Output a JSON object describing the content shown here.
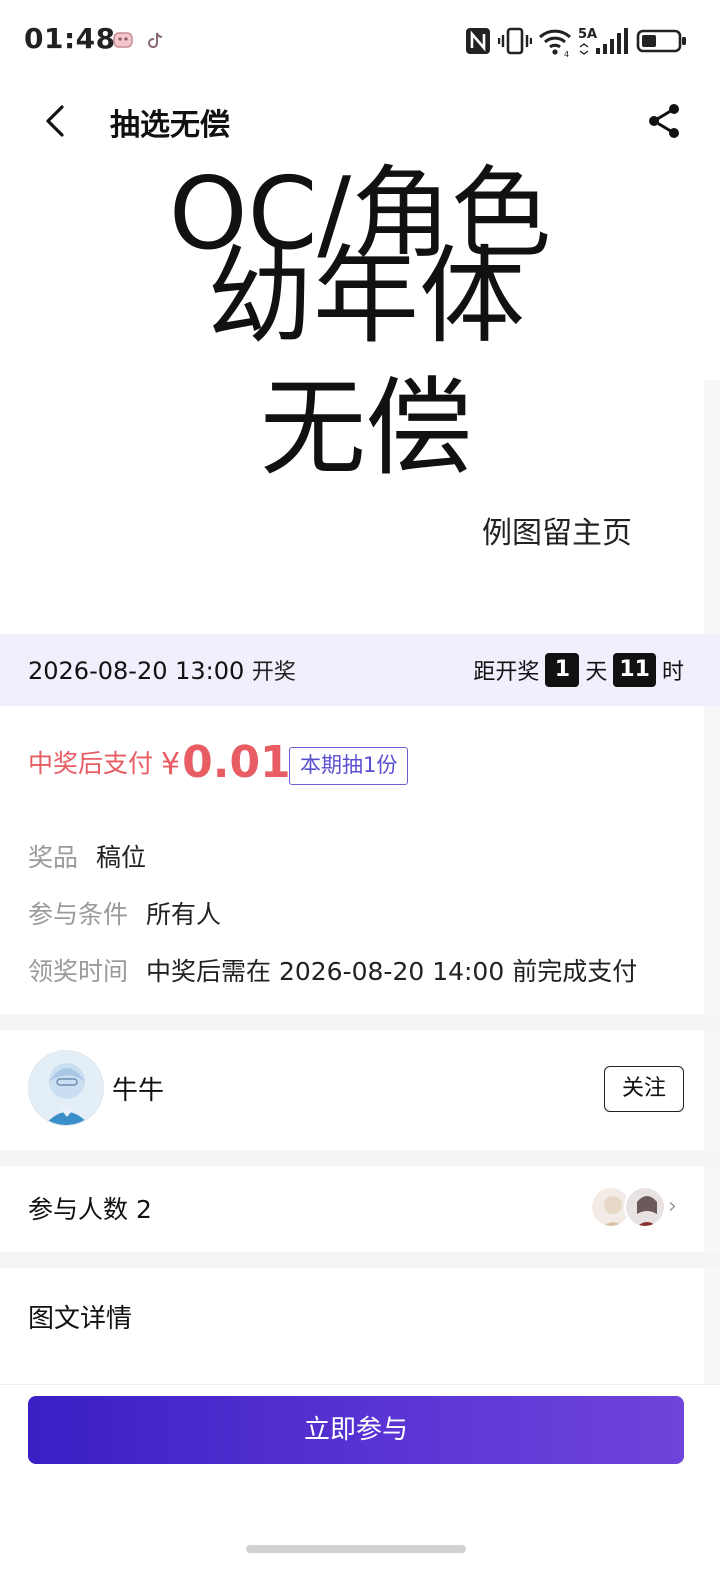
{
  "status_bar": {
    "time": "01:48",
    "network_label": "5A",
    "icons": [
      "app-notification-icon",
      "tiktok-icon",
      "nfc-icon",
      "vibrate-icon",
      "wifi-icon",
      "cellular-signal-icon",
      "battery-icon"
    ]
  },
  "nav": {
    "title": "抽选无偿",
    "back_icon": "chevron-left-icon",
    "share_icon": "share-icon"
  },
  "hero": {
    "line_partial": "OC/角色",
    "line1": "幼年体",
    "line2": "无偿",
    "note": "例图留主页"
  },
  "draw": {
    "datetime": "2026-08-20 13:00",
    "suffix": "开奖",
    "countdown_prefix": "距开奖",
    "days": "1",
    "days_unit": "天",
    "hours": "11",
    "hours_unit": "时"
  },
  "price": {
    "label": "中奖后支付",
    "currency": "¥",
    "value": "0.01",
    "quota": "本期抽1份"
  },
  "info": {
    "prize_key": "奖品",
    "prize_val": "稿位",
    "condition_key": "参与条件",
    "condition_val": "所有人",
    "claim_key": "领奖时间",
    "claim_val": "中奖后需在 2026-08-20 14:00 前完成支付"
  },
  "author": {
    "name": "牛牛",
    "follow_label": "关注"
  },
  "participants": {
    "label": "参与人数 2",
    "chevron": "›"
  },
  "details": {
    "title": "图文详情"
  },
  "cta": {
    "label": "立即参与"
  },
  "colors": {
    "price_red": "#e85c63",
    "accent_purple": "#5a4fd0",
    "draw_bar_bg": "#f0effb",
    "cta_start": "#3a1fc4",
    "cta_end": "#6e45da"
  }
}
